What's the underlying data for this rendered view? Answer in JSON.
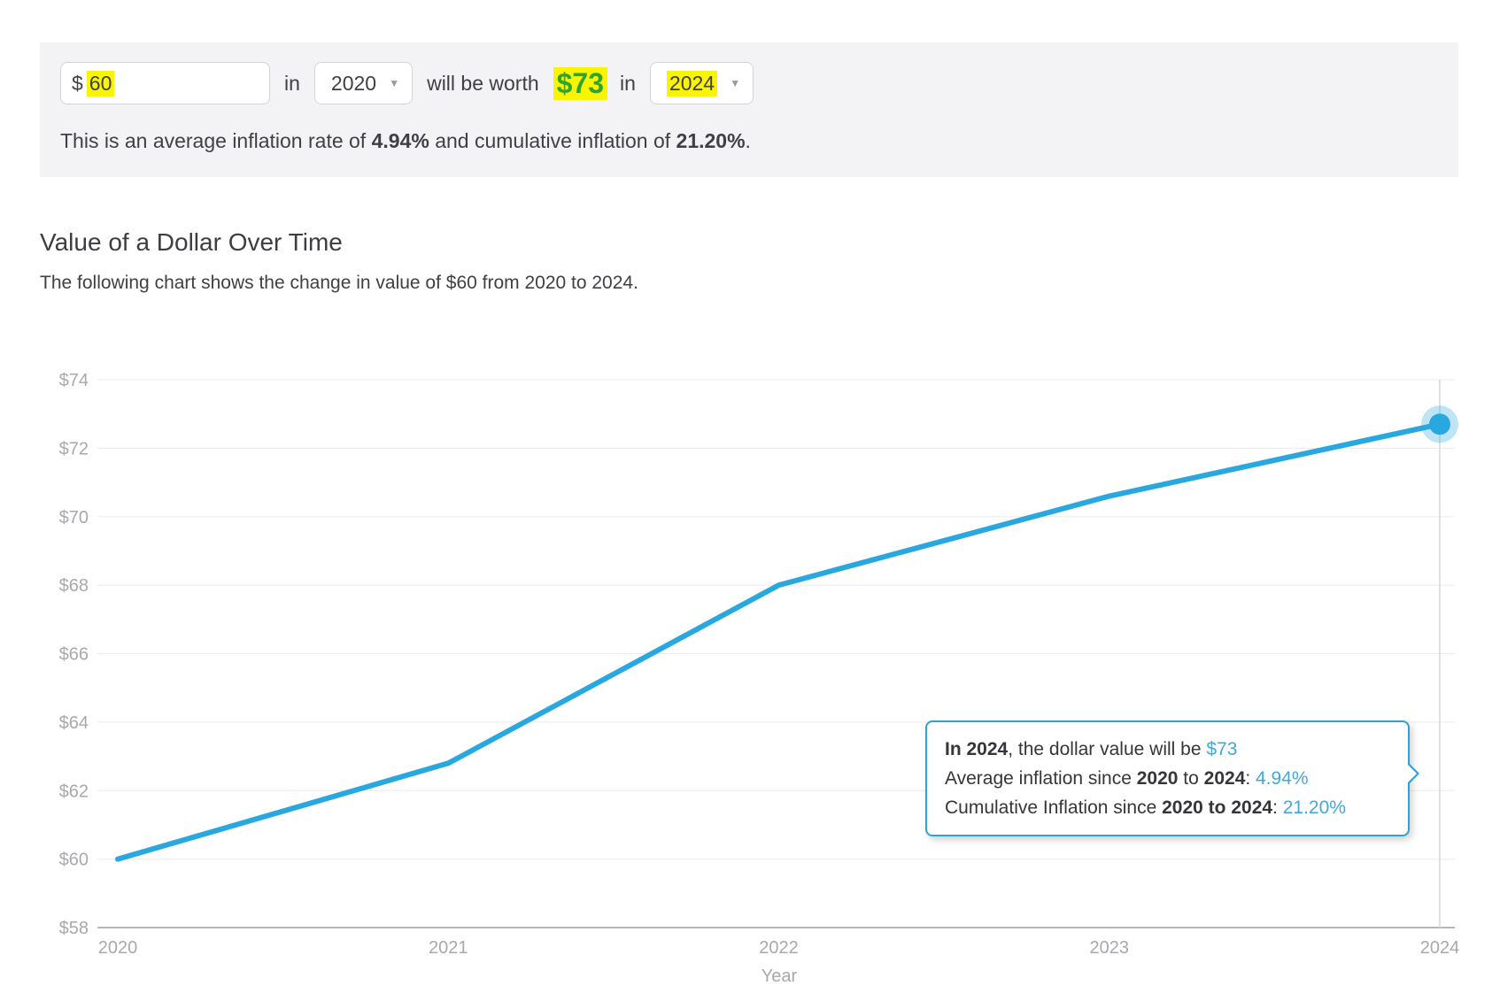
{
  "accent_color": "#29a8e0",
  "highlight_color": "#f9f500",
  "form": {
    "currency_symbol": "$",
    "amount": "60",
    "in_word_1": "in",
    "start_year": "2020",
    "worth_text": "will be worth",
    "result_amount": "$73",
    "in_word_2": "in",
    "end_year": "2024",
    "summary_pre": "This is an average inflation rate of ",
    "summary_avg": "4.94%",
    "summary_mid": " and cumulative inflation of ",
    "summary_cum": "21.20%",
    "summary_end": "."
  },
  "section": {
    "title": "Value of a Dollar Over Time",
    "subtitle": "The following chart shows the change in value of $60 from 2020 to 2024."
  },
  "chart_data": {
    "type": "line",
    "title": "Value of a Dollar Over Time",
    "x": [
      2020,
      2021,
      2022,
      2023,
      2024
    ],
    "categories": [
      "2020",
      "2021",
      "2022",
      "2023",
      "2024"
    ],
    "series": [
      {
        "name": "dollar-value",
        "values": [
          60.0,
          62.8,
          68.0,
          70.6,
          72.7
        ]
      }
    ],
    "xlabel": "Year",
    "ylabel": "",
    "ylim": [
      58,
      74
    ],
    "yticks": [
      58,
      60,
      62,
      64,
      66,
      68,
      70,
      72,
      74
    ],
    "ytick_labels": [
      "$58",
      "$60",
      "$62",
      "$64",
      "$66",
      "$68",
      "$70",
      "$72",
      "$74"
    ],
    "grid": true,
    "legend_position": "none",
    "line_color": "#29a8e0",
    "highlight_point": {
      "x": 2024,
      "y": 72.7
    }
  },
  "tooltip": {
    "l1_bold": "In 2024",
    "l1_text": ", the dollar value will be ",
    "l1_value": "$73",
    "l2_pre": "Average inflation since ",
    "l2_bold1": "2020",
    "l2_mid": " to ",
    "l2_bold2": "2024",
    "l2_sep": ": ",
    "l2_value": "4.94%",
    "l3_pre": "Cumulative Inflation since ",
    "l3_bold": "2020 to 2024",
    "l3_sep": ": ",
    "l3_value": "21.20%"
  }
}
